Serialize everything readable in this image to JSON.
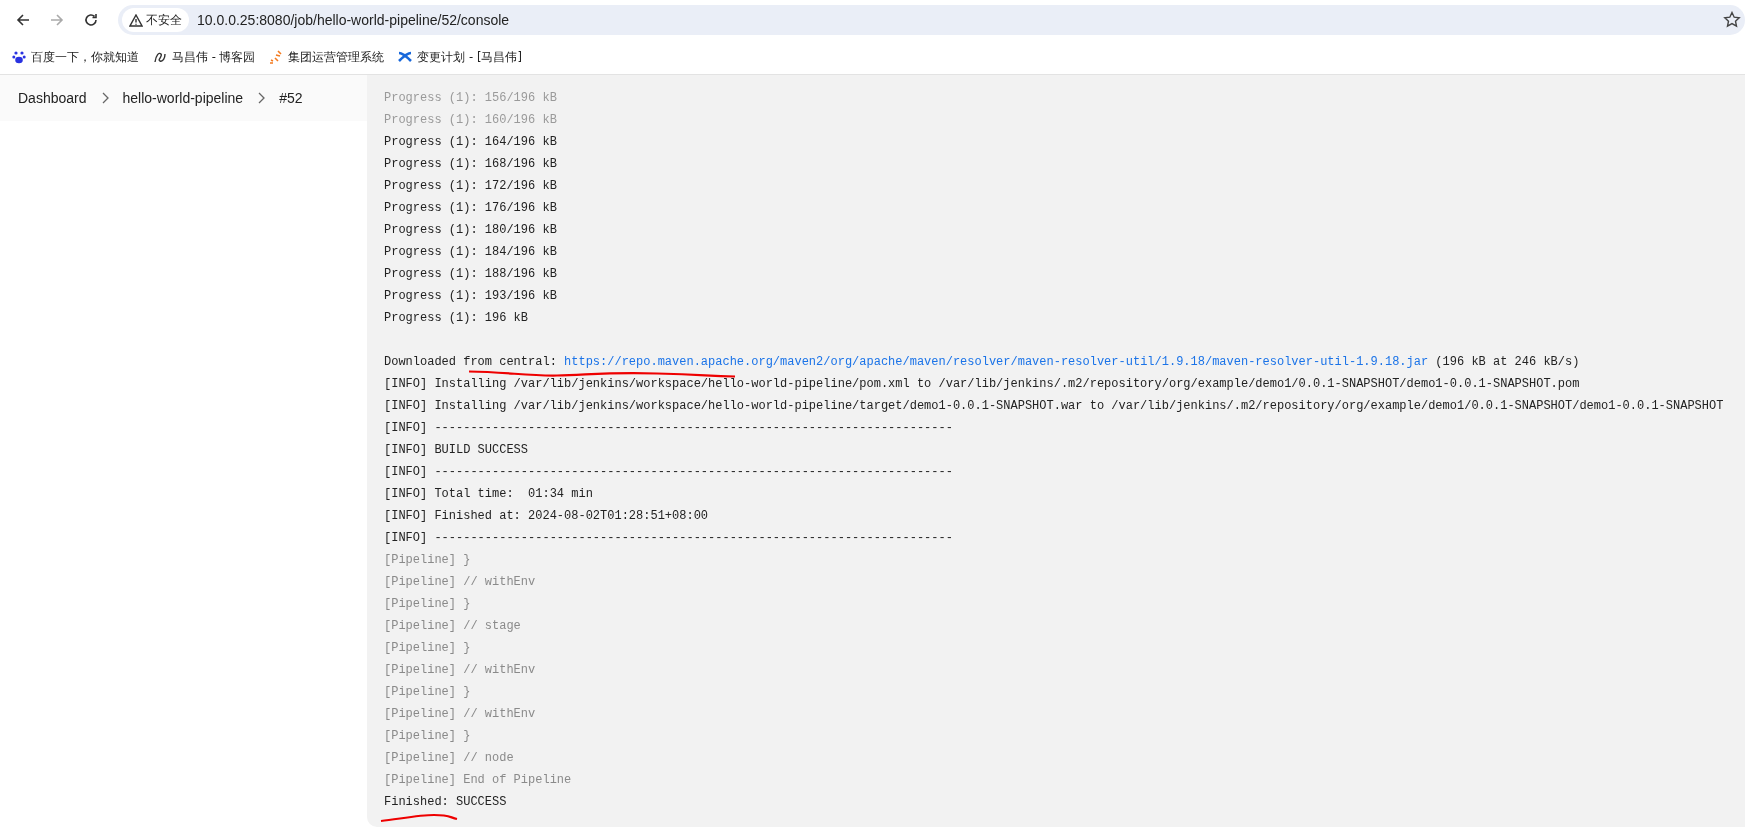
{
  "browser": {
    "nav": [
      {
        "kind": "back",
        "disabled": false
      },
      {
        "kind": "forward",
        "disabled": true
      },
      {
        "kind": "reload",
        "disabled": false
      }
    ],
    "security": "不安全",
    "url": "10.0.0.25:8080/job/hello-world-pipeline/52/console",
    "bookmarks": [
      {
        "kind": "paw",
        "label": "百度一下，你就知道"
      },
      {
        "kind": "swirl",
        "label": "马昌伟 - 博客园"
      },
      {
        "kind": "spark",
        "label": "集团运营管理系统"
      },
      {
        "kind": "cross",
        "label": "变更计划 - [马昌伟]"
      }
    ]
  },
  "breadcrumb": [
    "Dashboard",
    "hello-world-pipeline",
    "#52"
  ],
  "console": [
    {
      "kind": "faded",
      "text": "Progress (1): 156/196 kB"
    },
    {
      "kind": "faded",
      "text": "Progress (1): 160/196 kB"
    },
    {
      "kind": "plain",
      "text": "Progress (1): 164/196 kB"
    },
    {
      "kind": "plain",
      "text": "Progress (1): 168/196 kB"
    },
    {
      "kind": "plain",
      "text": "Progress (1): 172/196 kB"
    },
    {
      "kind": "plain",
      "text": "Progress (1): 176/196 kB"
    },
    {
      "kind": "plain",
      "text": "Progress (1): 180/196 kB"
    },
    {
      "kind": "plain",
      "text": "Progress (1): 184/196 kB"
    },
    {
      "kind": "plain",
      "text": "Progress (1): 188/196 kB"
    },
    {
      "kind": "plain",
      "text": "Progress (1): 193/196 kB"
    },
    {
      "kind": "plain",
      "text": "Progress (1): 196 kB"
    },
    {
      "kind": "blank"
    },
    {
      "kind": "link",
      "before": "Downloaded from central: ",
      "link": "https://repo.maven.apache.org/maven2/org/apache/maven/resolver/maven-resolver-util/1.9.18/maven-resolver-util-1.9.18.jar",
      "after": " (196 kB at 246 kB/s)"
    },
    {
      "kind": "plain",
      "text": "[INFO] Installing /var/lib/jenkins/workspace/hello-world-pipeline/pom.xml to /var/lib/jenkins/.m2/repository/org/example/demo1/0.0.1-SNAPSHOT/demo1-0.0.1-SNAPSHOT.pom"
    },
    {
      "kind": "plain",
      "text": "[INFO] Installing /var/lib/jenkins/workspace/hello-world-pipeline/target/demo1-0.0.1-SNAPSHOT.war to /var/lib/jenkins/.m2/repository/org/example/demo1/0.0.1-SNAPSHOT/demo1-0.0.1-SNAPSHOT"
    },
    {
      "kind": "plain",
      "text": "[INFO] ------------------------------------------------------------------------"
    },
    {
      "kind": "plain",
      "text": "[INFO] BUILD SUCCESS"
    },
    {
      "kind": "plain",
      "text": "[INFO] ------------------------------------------------------------------------"
    },
    {
      "kind": "plain",
      "text": "[INFO] Total time:  01:34 min"
    },
    {
      "kind": "plain",
      "text": "[INFO] Finished at: 2024-08-02T01:28:51+08:00"
    },
    {
      "kind": "plain",
      "text": "[INFO] ------------------------------------------------------------------------"
    },
    {
      "kind": "dim",
      "text": "[Pipeline] }"
    },
    {
      "kind": "dim",
      "text": "[Pipeline] // withEnv"
    },
    {
      "kind": "dim",
      "text": "[Pipeline] }"
    },
    {
      "kind": "dim",
      "text": "[Pipeline] // stage"
    },
    {
      "kind": "dim",
      "text": "[Pipeline] }"
    },
    {
      "kind": "dim",
      "text": "[Pipeline] // withEnv"
    },
    {
      "kind": "dim",
      "text": "[Pipeline] }"
    },
    {
      "kind": "dim",
      "text": "[Pipeline] // withEnv"
    },
    {
      "kind": "dim",
      "text": "[Pipeline] }"
    },
    {
      "kind": "dim",
      "text": "[Pipeline] // node"
    },
    {
      "kind": "dim",
      "text": "[Pipeline] End of Pipeline"
    },
    {
      "kind": "plain",
      "text": "Finished: SUCCESS"
    }
  ]
}
